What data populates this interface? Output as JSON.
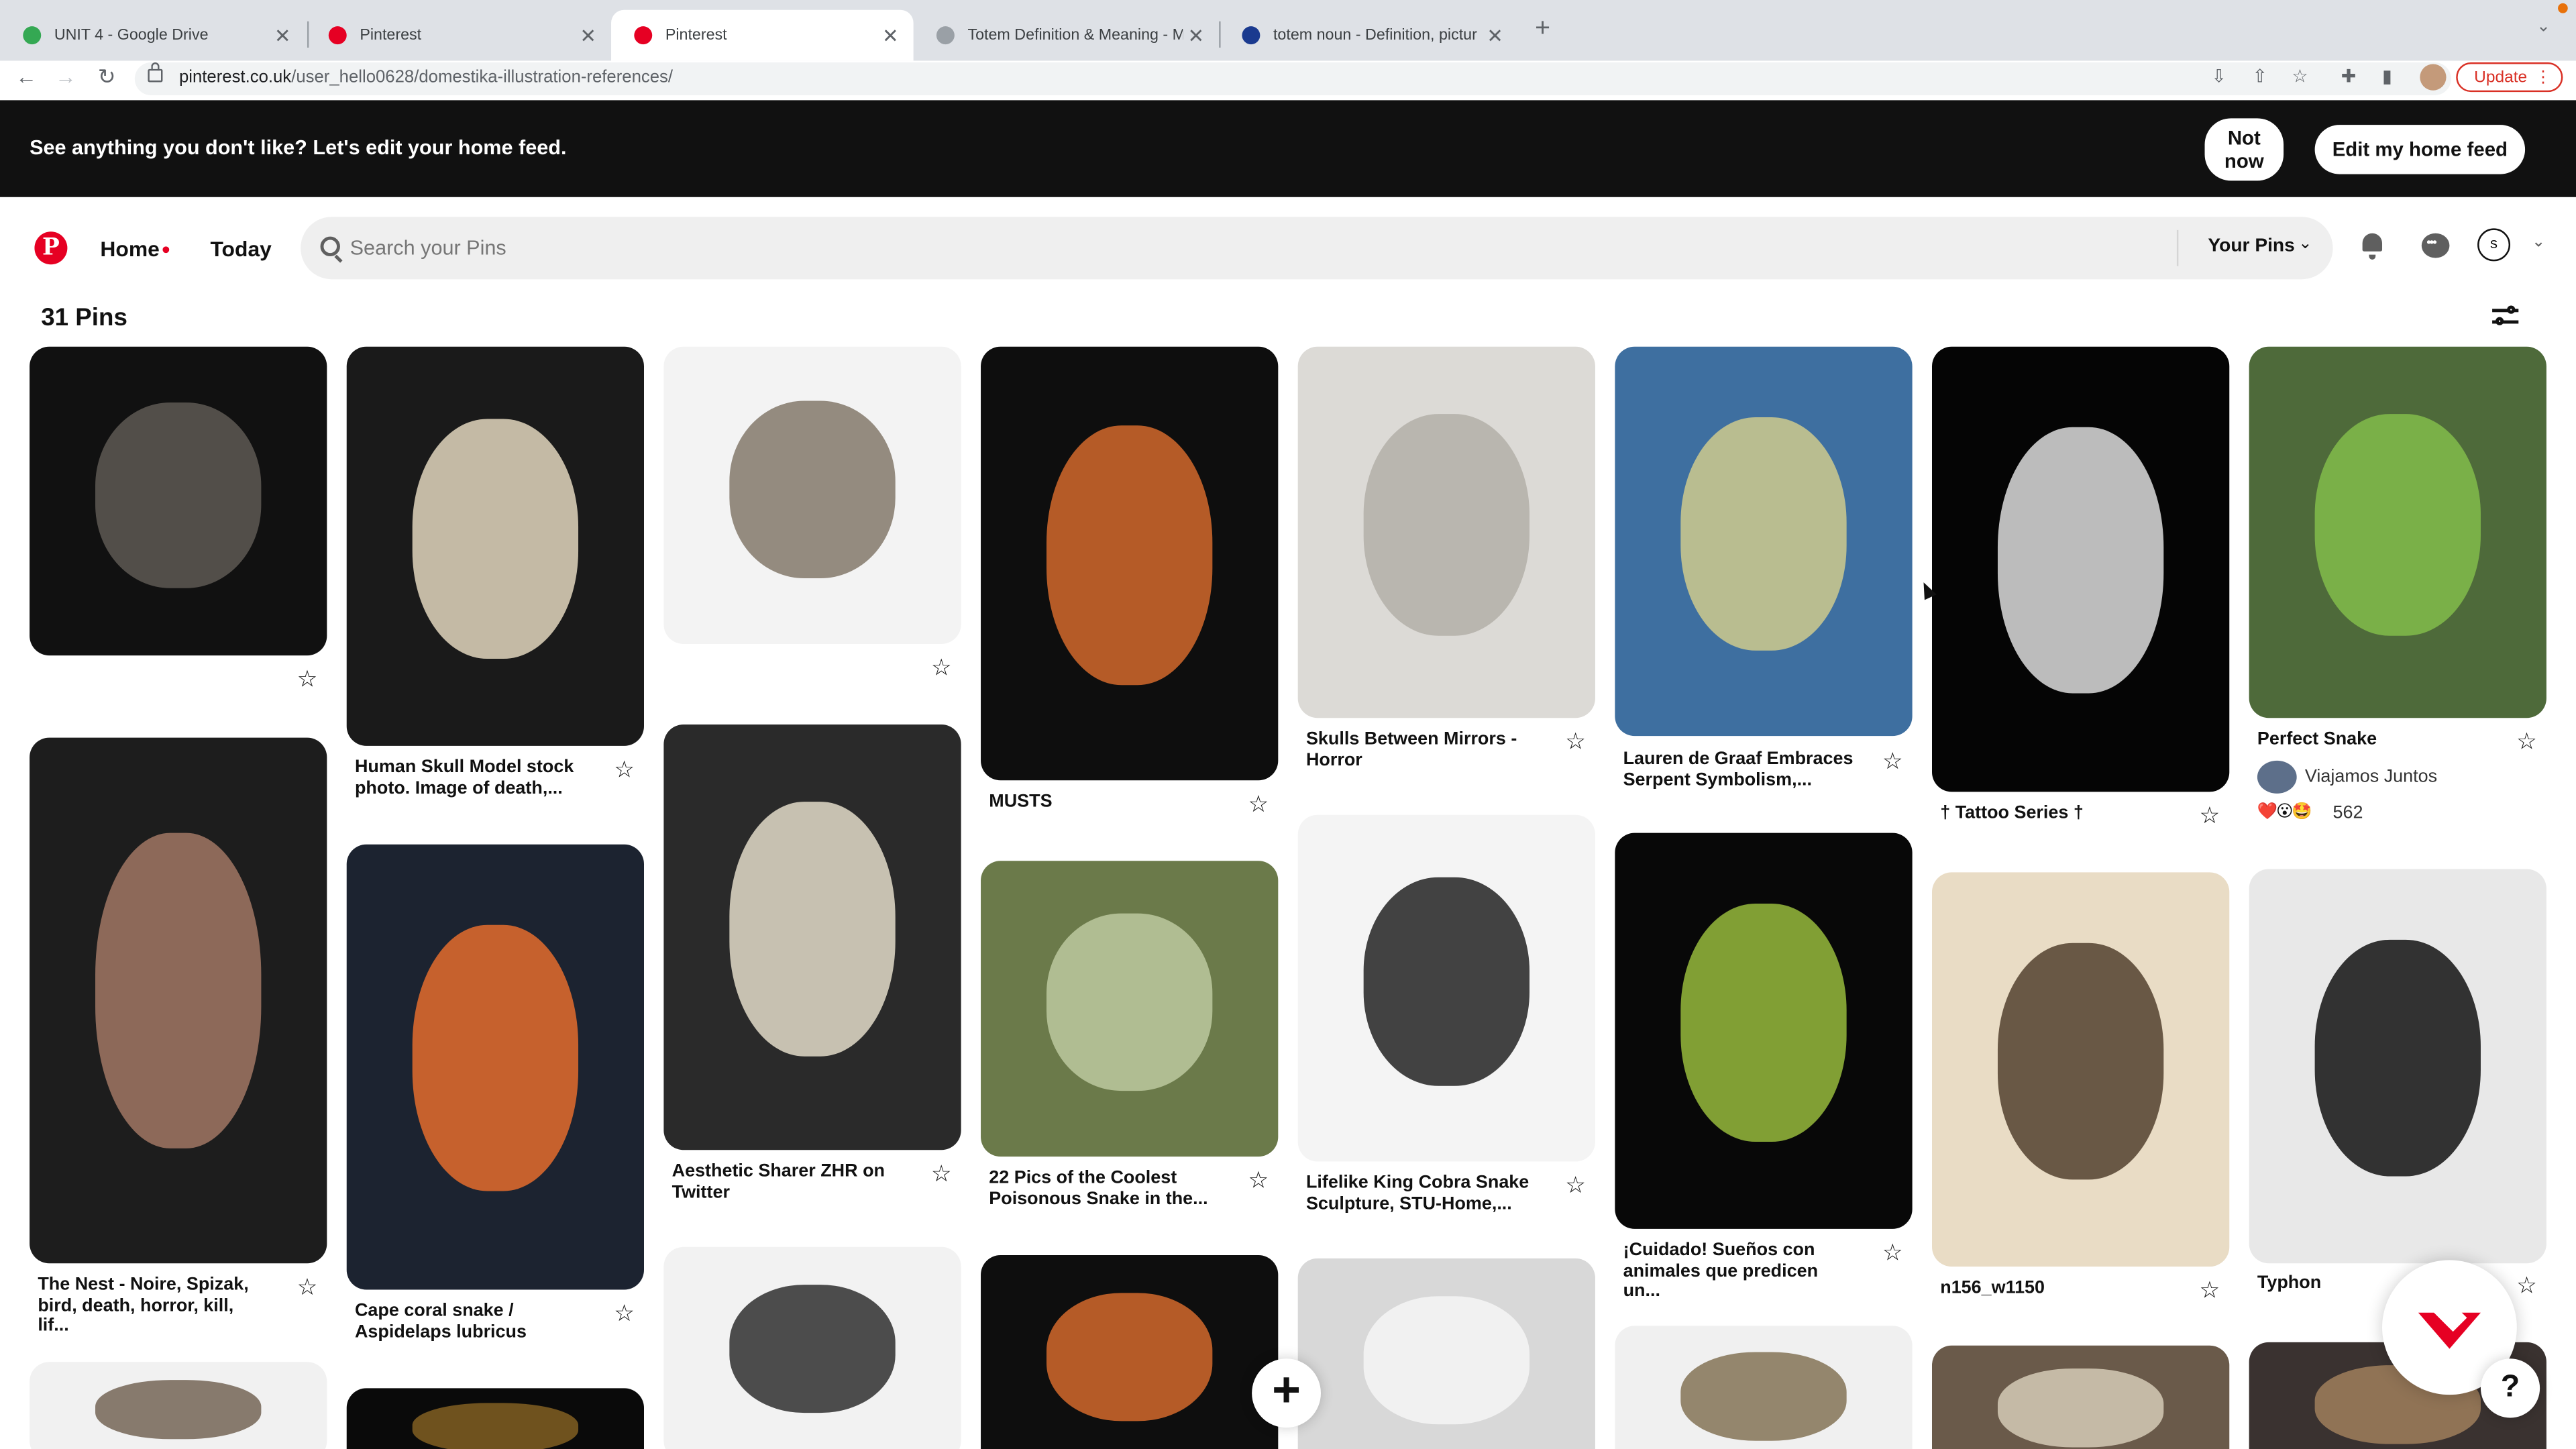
{
  "browser": {
    "tabs": [
      {
        "title": "UNIT 4 - Google Drive",
        "favicon_color": "#34a853"
      },
      {
        "title": "Pinterest",
        "favicon_color": "#e60023"
      },
      {
        "title": "Pinterest",
        "favicon_color": "#e60023"
      },
      {
        "title": "Totem Definition & Meaning - M",
        "favicon_color": "#9aa0a6"
      },
      {
        "title": "totem noun - Definition, pictur",
        "favicon_color": "#1a3a8f"
      }
    ],
    "url_domain": "pinterest.co.uk",
    "url_path": "/user_hello0628/domestika-illustration-references/",
    "update_label": "Update"
  },
  "banner": {
    "text": "See anything you don't like? Let's edit your home feed.",
    "not_now_line1": "Not",
    "not_now_line2": "now",
    "edit_label": "Edit my home feed"
  },
  "header": {
    "home_label": "Home",
    "today_label": "Today",
    "search_placeholder": "Search your Pins",
    "your_pins_label": "Your Pins",
    "avatar_letter": "s"
  },
  "board": {
    "pin_count": "31 Pins",
    "pins": [
      {
        "title": "",
        "img_color": "#111111",
        "subject_color": "#5a5550"
      },
      {
        "title": "Human Skull Model stock photo. Image of death,...",
        "img_color": "#1a1a1a",
        "subject_color": "#d7ccb5"
      },
      {
        "title": "",
        "img_color": "#f3f3f3",
        "subject_color": "#8a8072"
      },
      {
        "title": "MUSTS",
        "img_color": "#0e0e0e",
        "subject_color": "#c8642a"
      },
      {
        "title": "Skulls Between Mirrors - Horror",
        "img_color": "#dcdad6",
        "subject_color": "#b5b1ab"
      },
      {
        "title": "Lauren de Graaf Embraces Serpent Symbolism,...",
        "img_color": "#3e6fa0",
        "subject_color": "#c6c58e"
      },
      {
        "title": "† Tattoo Series †",
        "img_color": "#050505",
        "subject_color": "#d0d0d0"
      },
      {
        "title": "Perfect Snake",
        "img_color": "#4e6a3a",
        "subject_color": "#7fb84a"
      },
      {
        "title": "The Nest - Noire, Spizak, bird, death, horror, kill, lif...",
        "img_color": "#1d1d1d",
        "subject_color": "#9a7260"
      },
      {
        "title": "Cape coral snake / Aspidelaps lubricus",
        "img_color": "#1c2330",
        "subject_color": "#d9682e"
      },
      {
        "title": "Aesthetic Sharer ZHR on Twitter",
        "img_color": "#2a2a2a",
        "subject_color": "#d8d2c0"
      },
      {
        "title": "22 Pics of the Coolest Poisonous Snake in the...",
        "img_color": "#6b7a4a",
        "subject_color": "#b8c49a"
      },
      {
        "title": "Lifelike King Cobra Snake Sculpture, STU-Home,...",
        "img_color": "#f4f4f4",
        "subject_color": "#2f2f2f"
      },
      {
        "title": "¡Cuidado! Sueños con animales que predicen un...",
        "img_color": "#080808",
        "subject_color": "#8fb03a"
      },
      {
        "title": "n156_w1150",
        "img_color": "#e9dcc5",
        "subject_color": "#5b4936"
      },
      {
        "title": "Typhon",
        "img_color": "#e8e8e8",
        "subject_color": "#1e1e1e"
      },
      {
        "title": "",
        "img_color": "#f1f1f1",
        "subject_color": "#7b6d5e"
      },
      {
        "title": "",
        "img_color": "#0a0a0a",
        "subject_color": "#7a5a20"
      },
      {
        "title": "",
        "img_color": "#f2f2f2",
        "subject_color": "#3a3a3a"
      },
      {
        "title": "",
        "img_color": "#0e0e0e",
        "subject_color": "#c8642a"
      },
      {
        "title": "",
        "img_color": "#d8d8d8",
        "subject_color": "#f4f4f4"
      },
      {
        "title": "",
        "img_color": "#f0f0f0",
        "subject_color": "#8a7a5e"
      },
      {
        "title": "",
        "img_color": "#6a5a4a",
        "subject_color": "#cfc4b0"
      },
      {
        "title": "",
        "img_color": "#3a3230",
        "subject_color": "#9a7a5a"
      }
    ],
    "featured_author": "Viajamos Juntos",
    "featured_reactions": "❤️😮🤩",
    "featured_reaction_count": "562"
  },
  "icons": {
    "save": "star-outline-icon",
    "brand": "pinterest-logo",
    "accent": "#e60023"
  },
  "fab": {
    "plus": "+",
    "help": "?"
  }
}
